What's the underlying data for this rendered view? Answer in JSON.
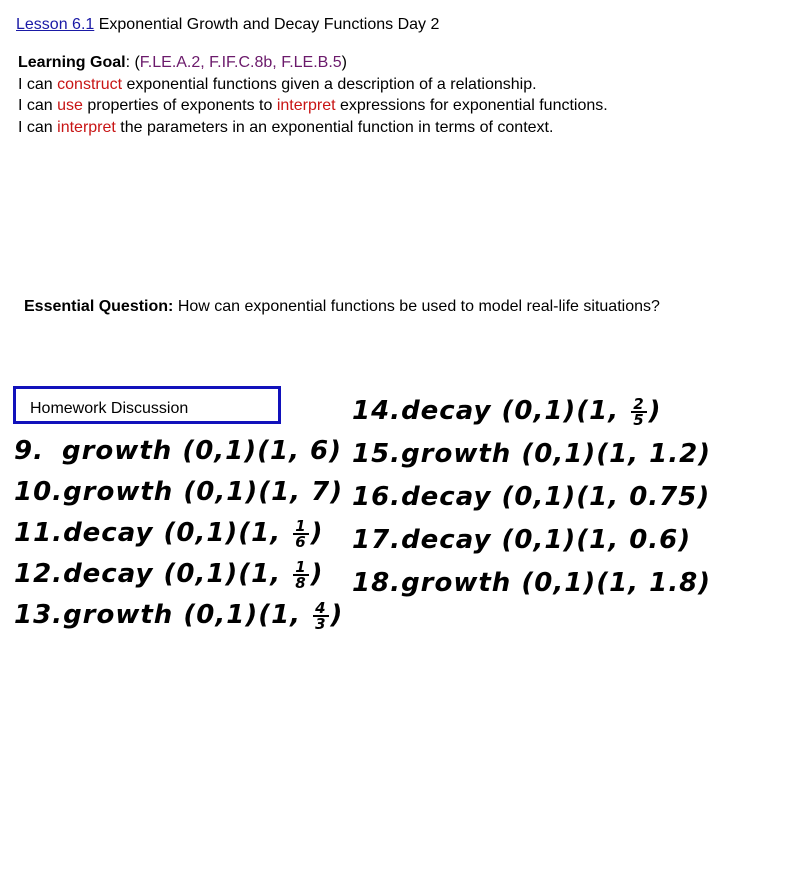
{
  "header": {
    "lesson_link": "Lesson 6.1",
    "title": "Exponential Growth and Decay Functions Day 2"
  },
  "learning_goal": {
    "label": "Learning Goal",
    "colon": ": (",
    "standards": "F.LE.A.2, F.IF.C.8b, F.LE.B.5",
    "close": ")",
    "lines": [
      {
        "pre": "I can ",
        "hl": "construct",
        "post": " exponential functions given a description of a relationship."
      },
      {
        "pre": "I can ",
        "hl": "use",
        "mid": " properties of exponents to ",
        "hl2": "interpret",
        "post": " expressions for exponential functions."
      },
      {
        "pre": "I can ",
        "hl": "interpret",
        "post": " the parameters in an exponential function in terms of context."
      }
    ]
  },
  "essential_question": {
    "label": "Essential Question:",
    "text": " How can exponential functions be used to model real-life situations?"
  },
  "homework": {
    "box_label": "Homework Discussion",
    "left": [
      {
        "num": "9.",
        "type": "growth",
        "p1": "(0,1)",
        "p2_pre": "(1, ",
        "p2_val": "6",
        "p2_post": ")"
      },
      {
        "num": "10.",
        "type": "growth",
        "p1": "(0,1)",
        "p2_pre": "(1, ",
        "p2_val": "7",
        "p2_post": ")"
      },
      {
        "num": "11.",
        "type": "decay",
        "p1": "(0,1)",
        "p2_pre": "(1, ",
        "frac_n": "1",
        "frac_d": "6",
        "p2_post": ")"
      },
      {
        "num": "12.",
        "type": "decay",
        "p1": "(0,1)",
        "p2_pre": "(1, ",
        "frac_n": "1",
        "frac_d": "8",
        "p2_post": ")"
      },
      {
        "num": "13.",
        "type": "growth",
        "p1": "(0,1)",
        "p2_pre": "(1, ",
        "frac_n": "4",
        "frac_d": "3",
        "p2_post": ")"
      }
    ],
    "right": [
      {
        "num": "14.",
        "type": "decay",
        "p1": "(0,1)",
        "p2_pre": "(1, ",
        "frac_n": "2",
        "frac_d": "5",
        "p2_post": ")"
      },
      {
        "num": "15.",
        "type": "growth",
        "p1": "(0,1)",
        "p2_pre": "(1, ",
        "p2_val": "1.2",
        "p2_post": ")"
      },
      {
        "num": "16.",
        "type": "decay",
        "p1": "(0,1)",
        "p2_pre": "(1, ",
        "p2_val": "0.75",
        "p2_post": ")"
      },
      {
        "num": "17.",
        "type": "decay",
        "p1": "(0,1)",
        "p2_pre": "(1, ",
        "p2_val": "0.6",
        "p2_post": ")"
      },
      {
        "num": "18.",
        "type": "growth",
        "p1": "(0,1)",
        "p2_pre": "(1, ",
        "p2_val": "1.8",
        "p2_post": ")"
      }
    ]
  }
}
